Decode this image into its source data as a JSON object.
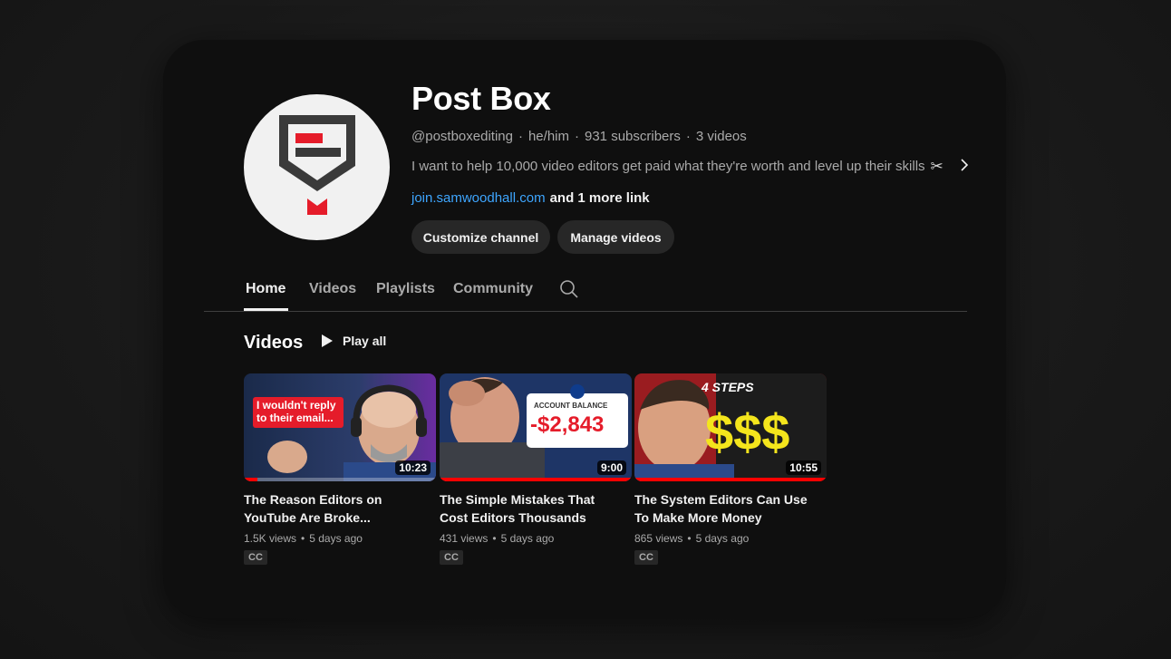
{
  "channel": {
    "name": "Post Box",
    "handle": "@postboxediting",
    "pronouns": "he/him",
    "subscribers": "931 subscribers",
    "video_count": "3 videos",
    "separator": "·",
    "description": "I want to help 10,000 video editors get paid what they're worth and level up their skills",
    "link": "join.samwoodhall.com",
    "more_links": "and 1 more link"
  },
  "buttons": {
    "customize": "Customize channel",
    "manage": "Manage videos"
  },
  "tabs": [
    {
      "label": "Home",
      "active": true
    },
    {
      "label": "Videos",
      "active": false
    },
    {
      "label": "Playlists",
      "active": false
    },
    {
      "label": "Community",
      "active": false
    }
  ],
  "section": {
    "title": "Videos",
    "play_all": "Play all"
  },
  "videos": [
    {
      "title": "The Reason Editors on YouTube Are Broke...",
      "views": "1.5K views",
      "age": "5 days ago",
      "duration": "10:23",
      "cc": "CC",
      "watched_fraction": 0.07,
      "thumb_text": [
        "I wouldn't reply",
        "to their email..."
      ]
    },
    {
      "title": "The Simple Mistakes That Cost Editors Thousands",
      "views": "431 views",
      "age": "5 days ago",
      "duration": "9:00",
      "cc": "CC",
      "watched_fraction": 1.0,
      "thumb_text": [
        "ACCOUNT BALANCE",
        "-$2,843"
      ]
    },
    {
      "title": "The System Editors Can Use To Make More Money",
      "views": "865 views",
      "age": "5 days ago",
      "duration": "10:55",
      "cc": "CC",
      "watched_fraction": 1.0,
      "thumb_text": [
        "4 STEPS",
        "$$$"
      ]
    }
  ],
  "colors": {
    "link": "#3ea6ff",
    "brand_red": "#e51c2a",
    "logo_dark": "#3a3a3a",
    "progress_red": "#ff0000"
  },
  "icons": [
    "scissors-icon",
    "chevron-right-icon",
    "search-icon",
    "play-icon"
  ]
}
